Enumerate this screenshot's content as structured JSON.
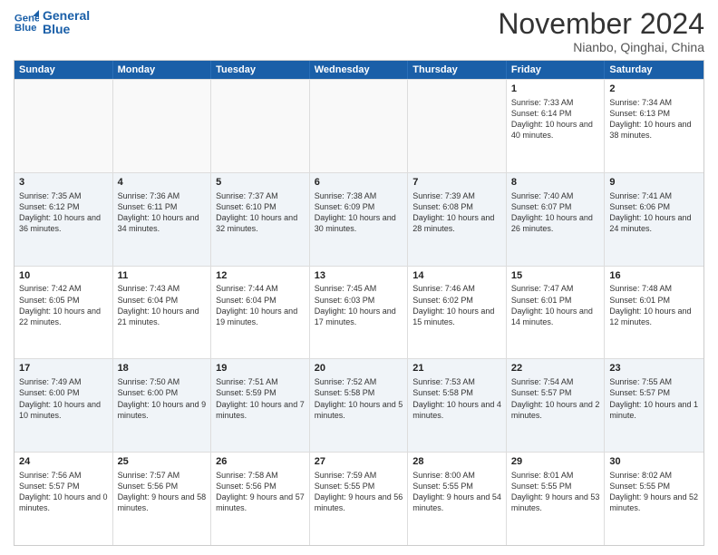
{
  "header": {
    "logo_line1": "General",
    "logo_line2": "Blue",
    "month_title": "November 2024",
    "location": "Nianbo, Qinghai, China"
  },
  "days_of_week": [
    "Sunday",
    "Monday",
    "Tuesday",
    "Wednesday",
    "Thursday",
    "Friday",
    "Saturday"
  ],
  "weeks": [
    {
      "alt": false,
      "days": [
        {
          "num": "",
          "info": ""
        },
        {
          "num": "",
          "info": ""
        },
        {
          "num": "",
          "info": ""
        },
        {
          "num": "",
          "info": ""
        },
        {
          "num": "",
          "info": ""
        },
        {
          "num": "1",
          "info": "Sunrise: 7:33 AM\nSunset: 6:14 PM\nDaylight: 10 hours and 40 minutes."
        },
        {
          "num": "2",
          "info": "Sunrise: 7:34 AM\nSunset: 6:13 PM\nDaylight: 10 hours and 38 minutes."
        }
      ]
    },
    {
      "alt": true,
      "days": [
        {
          "num": "3",
          "info": "Sunrise: 7:35 AM\nSunset: 6:12 PM\nDaylight: 10 hours and 36 minutes."
        },
        {
          "num": "4",
          "info": "Sunrise: 7:36 AM\nSunset: 6:11 PM\nDaylight: 10 hours and 34 minutes."
        },
        {
          "num": "5",
          "info": "Sunrise: 7:37 AM\nSunset: 6:10 PM\nDaylight: 10 hours and 32 minutes."
        },
        {
          "num": "6",
          "info": "Sunrise: 7:38 AM\nSunset: 6:09 PM\nDaylight: 10 hours and 30 minutes."
        },
        {
          "num": "7",
          "info": "Sunrise: 7:39 AM\nSunset: 6:08 PM\nDaylight: 10 hours and 28 minutes."
        },
        {
          "num": "8",
          "info": "Sunrise: 7:40 AM\nSunset: 6:07 PM\nDaylight: 10 hours and 26 minutes."
        },
        {
          "num": "9",
          "info": "Sunrise: 7:41 AM\nSunset: 6:06 PM\nDaylight: 10 hours and 24 minutes."
        }
      ]
    },
    {
      "alt": false,
      "days": [
        {
          "num": "10",
          "info": "Sunrise: 7:42 AM\nSunset: 6:05 PM\nDaylight: 10 hours and 22 minutes."
        },
        {
          "num": "11",
          "info": "Sunrise: 7:43 AM\nSunset: 6:04 PM\nDaylight: 10 hours and 21 minutes."
        },
        {
          "num": "12",
          "info": "Sunrise: 7:44 AM\nSunset: 6:04 PM\nDaylight: 10 hours and 19 minutes."
        },
        {
          "num": "13",
          "info": "Sunrise: 7:45 AM\nSunset: 6:03 PM\nDaylight: 10 hours and 17 minutes."
        },
        {
          "num": "14",
          "info": "Sunrise: 7:46 AM\nSunset: 6:02 PM\nDaylight: 10 hours and 15 minutes."
        },
        {
          "num": "15",
          "info": "Sunrise: 7:47 AM\nSunset: 6:01 PM\nDaylight: 10 hours and 14 minutes."
        },
        {
          "num": "16",
          "info": "Sunrise: 7:48 AM\nSunset: 6:01 PM\nDaylight: 10 hours and 12 minutes."
        }
      ]
    },
    {
      "alt": true,
      "days": [
        {
          "num": "17",
          "info": "Sunrise: 7:49 AM\nSunset: 6:00 PM\nDaylight: 10 hours and 10 minutes."
        },
        {
          "num": "18",
          "info": "Sunrise: 7:50 AM\nSunset: 6:00 PM\nDaylight: 10 hours and 9 minutes."
        },
        {
          "num": "19",
          "info": "Sunrise: 7:51 AM\nSunset: 5:59 PM\nDaylight: 10 hours and 7 minutes."
        },
        {
          "num": "20",
          "info": "Sunrise: 7:52 AM\nSunset: 5:58 PM\nDaylight: 10 hours and 5 minutes."
        },
        {
          "num": "21",
          "info": "Sunrise: 7:53 AM\nSunset: 5:58 PM\nDaylight: 10 hours and 4 minutes."
        },
        {
          "num": "22",
          "info": "Sunrise: 7:54 AM\nSunset: 5:57 PM\nDaylight: 10 hours and 2 minutes."
        },
        {
          "num": "23",
          "info": "Sunrise: 7:55 AM\nSunset: 5:57 PM\nDaylight: 10 hours and 1 minute."
        }
      ]
    },
    {
      "alt": false,
      "days": [
        {
          "num": "24",
          "info": "Sunrise: 7:56 AM\nSunset: 5:57 PM\nDaylight: 10 hours and 0 minutes."
        },
        {
          "num": "25",
          "info": "Sunrise: 7:57 AM\nSunset: 5:56 PM\nDaylight: 9 hours and 58 minutes."
        },
        {
          "num": "26",
          "info": "Sunrise: 7:58 AM\nSunset: 5:56 PM\nDaylight: 9 hours and 57 minutes."
        },
        {
          "num": "27",
          "info": "Sunrise: 7:59 AM\nSunset: 5:55 PM\nDaylight: 9 hours and 56 minutes."
        },
        {
          "num": "28",
          "info": "Sunrise: 8:00 AM\nSunset: 5:55 PM\nDaylight: 9 hours and 54 minutes."
        },
        {
          "num": "29",
          "info": "Sunrise: 8:01 AM\nSunset: 5:55 PM\nDaylight: 9 hours and 53 minutes."
        },
        {
          "num": "30",
          "info": "Sunrise: 8:02 AM\nSunset: 5:55 PM\nDaylight: 9 hours and 52 minutes."
        }
      ]
    }
  ]
}
